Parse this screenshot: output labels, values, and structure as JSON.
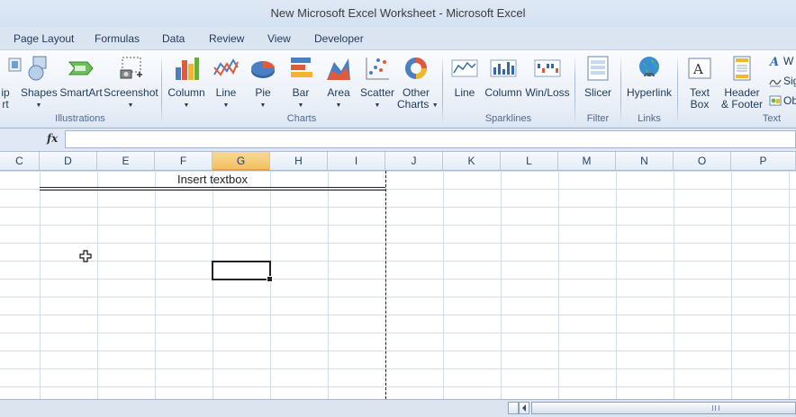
{
  "window": {
    "title": "New Microsoft Excel Worksheet  -  Microsoft Excel"
  },
  "tabs": [
    "Page Layout",
    "Formulas",
    "Data",
    "Review",
    "View",
    "Developer"
  ],
  "ribbon": {
    "illustrations": {
      "clip_art_partial": {
        "line1": "ip",
        "line2": "rt"
      },
      "shapes": "Shapes",
      "smartart": "SmartArt",
      "screenshot": "Screenshot",
      "group_label": "Illustrations"
    },
    "charts": {
      "column": "Column",
      "line": "Line",
      "pie": "Pie",
      "bar": "Bar",
      "area": "Area",
      "scatter": "Scatter",
      "other_line1": "Other",
      "other_line2": "Charts",
      "group_label": "Charts"
    },
    "sparklines": {
      "line": "Line",
      "column": "Column",
      "winloss": "Win/Loss",
      "group_label": "Sparklines"
    },
    "filter": {
      "slicer": "Slicer",
      "group_label": "Filter"
    },
    "links": {
      "hyperlink": "Hyperlink",
      "group_label": "Links"
    },
    "text": {
      "textbox_line1": "Text",
      "textbox_line2": "Box",
      "header_line1": "Header",
      "header_line2": "& Footer",
      "wordart_partial": "W",
      "signature_partial": "Sig",
      "object_partial": "Ob",
      "group_label": "Text"
    }
  },
  "formula_bar": {
    "fx": "fx",
    "value": ""
  },
  "columns": [
    "C",
    "D",
    "E",
    "F",
    "G",
    "H",
    "I",
    "J",
    "K",
    "L",
    "M",
    "N",
    "O",
    "P"
  ],
  "selected_column": "G",
  "sheet": {
    "textbox_label": "Insert textbox"
  },
  "colors": {
    "accent": "#f1c15f",
    "ribbon_bg": "#e8eef7",
    "text": "#1e395b"
  }
}
